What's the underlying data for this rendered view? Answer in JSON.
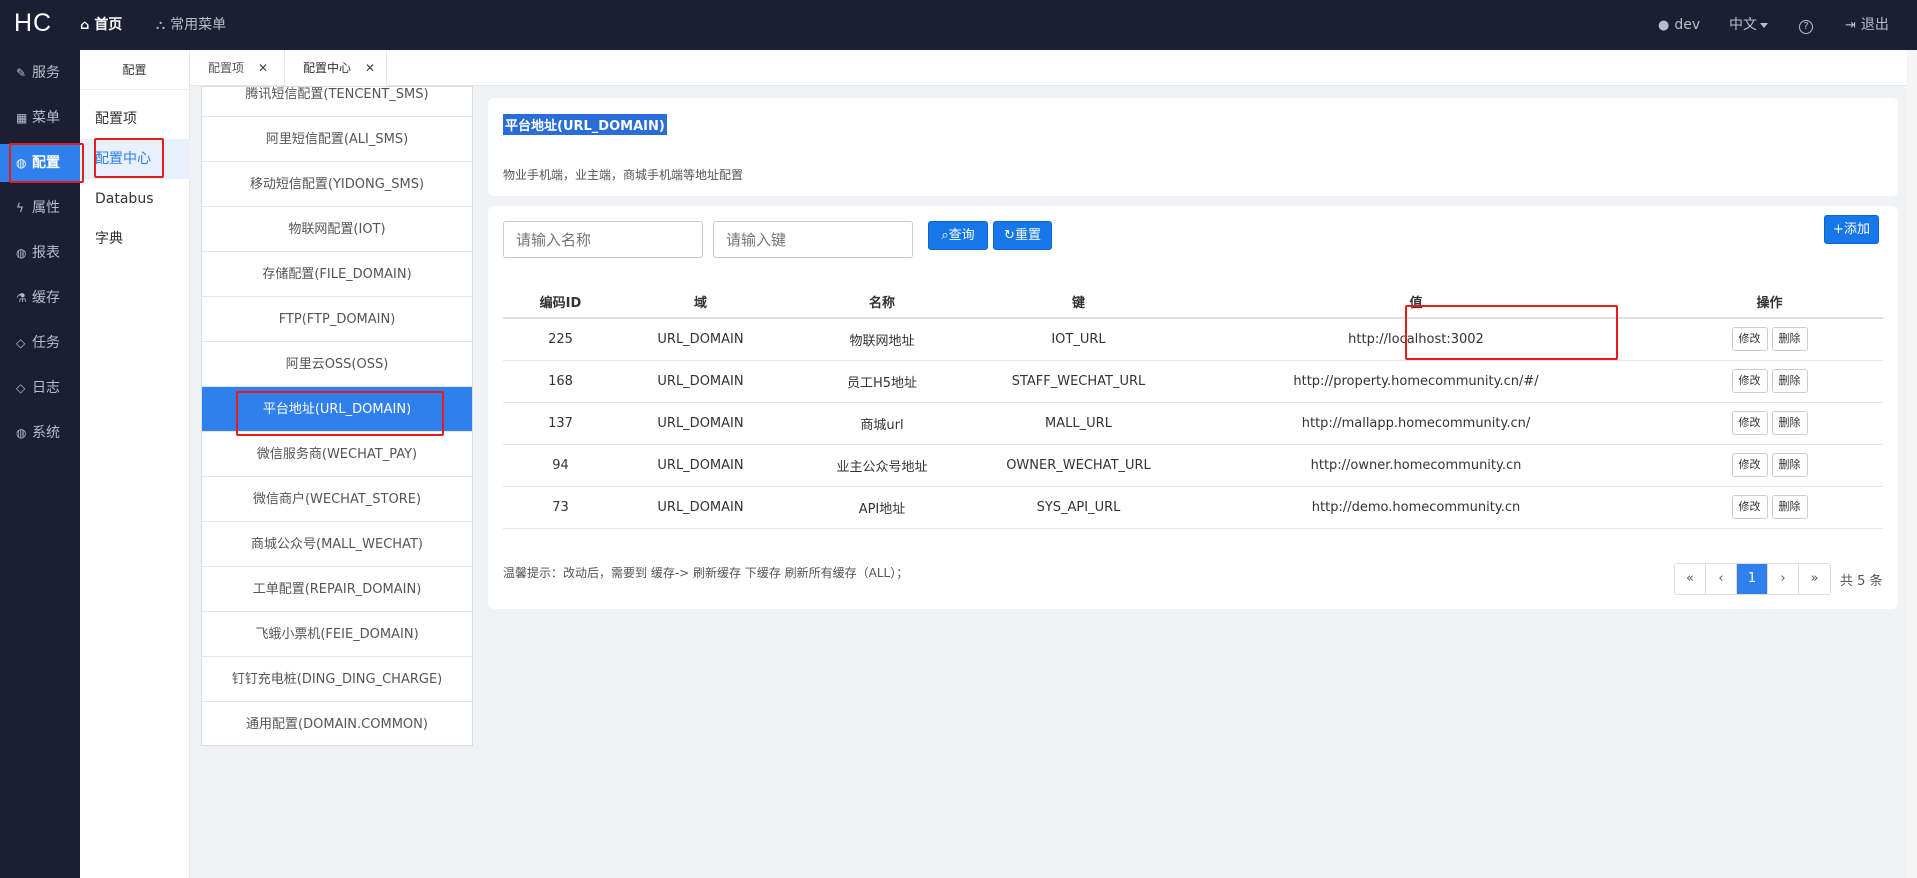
{
  "topbar": {
    "logo": "HC",
    "home": "首页",
    "common_menu": "常用菜单",
    "user": "dev",
    "language": "中文",
    "help_icon": "?",
    "logout": "退出"
  },
  "sidebar": {
    "items": [
      {
        "label": "服务",
        "icon": "edit-icon"
      },
      {
        "label": "菜单",
        "icon": "grid-icon"
      },
      {
        "label": "配置",
        "icon": "globe-icon"
      },
      {
        "label": "属性",
        "icon": "bolt-icon"
      },
      {
        "label": "报表",
        "icon": "globe-icon"
      },
      {
        "label": "缓存",
        "icon": "flask-icon"
      },
      {
        "label": "任务",
        "icon": "diamond-icon"
      },
      {
        "label": "日志",
        "icon": "diamond-icon"
      },
      {
        "label": "系统",
        "icon": "globe-icon"
      }
    ]
  },
  "submenu": {
    "title": "配置",
    "items": [
      "配置项",
      "配置中心",
      "Databus",
      "字典"
    ]
  },
  "tabs": [
    {
      "label": "配置项"
    },
    {
      "label": "配置中心"
    }
  ],
  "domains": [
    "腾讯短信配置(TENCENT_SMS)",
    "阿里短信配置(ALI_SMS)",
    "移动短信配置(YIDONG_SMS)",
    "物联网配置(IOT)",
    "存储配置(FILE_DOMAIN)",
    "FTP(FTP_DOMAIN)",
    "阿里云OSS(OSS)",
    "平台地址(URL_DOMAIN)",
    "微信服务商(WECHAT_PAY)",
    "微信商户(WECHAT_STORE)",
    "商城公众号(MALL_WECHAT)",
    "工单配置(REPAIR_DOMAIN)",
    "飞蛾小票机(FEIE_DOMAIN)",
    "钉钉充电桩(DING_DING_CHARGE)",
    "通用配置(DOMAIN.COMMON)"
  ],
  "detail": {
    "title": "平台地址(URL_DOMAIN)",
    "description": "物业手机端，业主端，商城手机端等地址配置"
  },
  "search": {
    "name_placeholder": "请输入名称",
    "key_placeholder": "请输入键",
    "query": "查询",
    "reset": "重置",
    "add": "添加"
  },
  "table": {
    "headers": [
      "编码ID",
      "域",
      "名称",
      "键",
      "值",
      "操作"
    ],
    "rows": [
      {
        "id": "225",
        "domain": "URL_DOMAIN",
        "name": "物联网地址",
        "key": "IOT_URL",
        "value": "http://localhost:3002"
      },
      {
        "id": "168",
        "domain": "URL_DOMAIN",
        "name": "员工H5地址",
        "key": "STAFF_WECHAT_URL",
        "value": "http://property.homecommunity.cn/#/"
      },
      {
        "id": "137",
        "domain": "URL_DOMAIN",
        "name": "商城url",
        "key": "MALL_URL",
        "value": "http://mallapp.homecommunity.cn/"
      },
      {
        "id": "94",
        "domain": "URL_DOMAIN",
        "name": "业主公众号地址",
        "key": "OWNER_WECHAT_URL",
        "value": "http://owner.homecommunity.cn"
      },
      {
        "id": "73",
        "domain": "URL_DOMAIN",
        "name": "API地址",
        "key": "SYS_API_URL",
        "value": "http://demo.homecommunity.cn"
      }
    ],
    "edit": "修改",
    "delete": "删除"
  },
  "tip": "温馨提示：改动后，需要到 缓存-> 刷新缓存 下缓存 刷新所有缓存（ALL）；",
  "pagination": {
    "first": "«",
    "prev": "‹",
    "current": "1",
    "next": "›",
    "last": "»",
    "total": "共 5 条"
  },
  "colors": {
    "topbar": "#1b1f33",
    "accent": "#2f80ed",
    "highlight_box": "#e61b1b"
  }
}
